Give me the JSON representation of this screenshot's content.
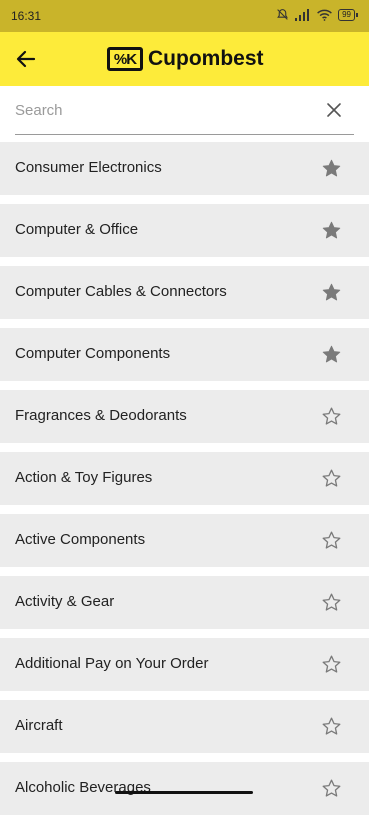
{
  "status_bar": {
    "time": "16:31",
    "battery": "99"
  },
  "header": {
    "logo_mark": "%K",
    "brand": "Cupombest"
  },
  "search": {
    "placeholder": "Search",
    "value": ""
  },
  "categories": [
    {
      "label": "Consumer Electronics",
      "favorite": true
    },
    {
      "label": "Computer & Office",
      "favorite": true
    },
    {
      "label": "Computer Cables & Connectors",
      "favorite": true
    },
    {
      "label": "Computer Components",
      "favorite": true
    },
    {
      "label": "Fragrances & Deodorants",
      "favorite": false
    },
    {
      "label": "Action & Toy Figures",
      "favorite": false
    },
    {
      "label": "Active Components",
      "favorite": false
    },
    {
      "label": "Activity & Gear",
      "favorite": false
    },
    {
      "label": "Additional Pay on Your Order",
      "favorite": false
    },
    {
      "label": "Aircraft",
      "favorite": false
    },
    {
      "label": "Alcoholic Beverages",
      "favorite": false
    }
  ],
  "colors": {
    "accent": "#fdeb3a",
    "status_bar": "#c9b42a",
    "row_bg": "#ececec",
    "star": "#7a7a7a"
  }
}
